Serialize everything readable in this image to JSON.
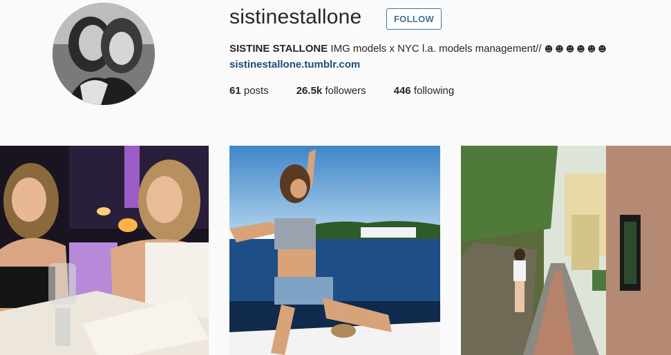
{
  "profile": {
    "username": "sistinestallone",
    "follow_label": "FOLLOW",
    "full_name": "SISTINE STALLONE",
    "bio_text": "IMG models x NYC l.a. models management//",
    "bio_emojis": "☻☻☻☻☻☻",
    "website": "sistinestallone.tumblr.com",
    "avatar_icon": "profile-photo"
  },
  "stats": {
    "posts_count": "61",
    "posts_label": "posts",
    "followers_count": "26.5k",
    "followers_label": "followers",
    "following_count": "446",
    "following_label": "following"
  },
  "grid": [
    {
      "name": "photo-restaurant-selfie"
    },
    {
      "name": "photo-boat-sea"
    },
    {
      "name": "photo-alley-walk"
    }
  ],
  "colors": {
    "accent": "#3f729b",
    "link": "#1e4d78",
    "background": "#fafafa",
    "text": "#262626"
  }
}
